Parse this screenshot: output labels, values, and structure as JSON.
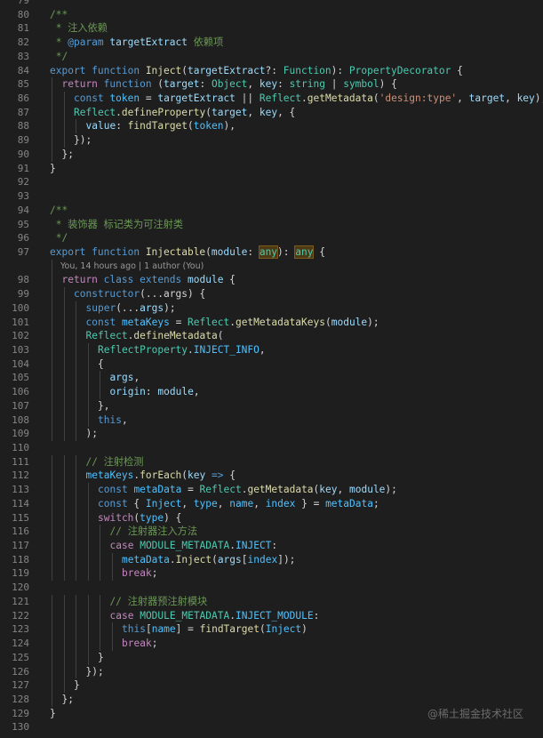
{
  "lines": [
    {
      "n": "79",
      "i": 0,
      "t": []
    },
    {
      "n": "80",
      "i": 0,
      "t": [
        [
          "cm",
          "/**"
        ]
      ]
    },
    {
      "n": "81",
      "i": 0,
      "t": [
        [
          "cm",
          " * 注入依赖"
        ]
      ]
    },
    {
      "n": "82",
      "i": 0,
      "t": [
        [
          "cm",
          " * "
        ],
        [
          "k",
          "@param"
        ],
        [
          "cm",
          " "
        ],
        [
          "v",
          "targetExtract"
        ],
        [
          "cm",
          " 依赖项"
        ]
      ]
    },
    {
      "n": "83",
      "i": 0,
      "t": [
        [
          "cm",
          " */"
        ]
      ]
    },
    {
      "n": "84",
      "i": 0,
      "t": [
        [
          "k",
          "export"
        ],
        [
          "p",
          " "
        ],
        [
          "k",
          "function"
        ],
        [
          "p",
          " "
        ],
        [
          "fn",
          "Inject"
        ],
        [
          "p",
          "("
        ],
        [
          "v",
          "targetExtract"
        ],
        [
          "p",
          "?: "
        ],
        [
          "ty",
          "Function"
        ],
        [
          "p",
          "): "
        ],
        [
          "ty",
          "PropertyDecorator"
        ],
        [
          "p",
          " {"
        ]
      ]
    },
    {
      "n": "85",
      "i": 1,
      "t": [
        [
          "c",
          "return"
        ],
        [
          "p",
          " "
        ],
        [
          "k",
          "function"
        ],
        [
          "p",
          " ("
        ],
        [
          "v",
          "target"
        ],
        [
          "p",
          ": "
        ],
        [
          "ty",
          "Object"
        ],
        [
          "p",
          ", "
        ],
        [
          "v",
          "key"
        ],
        [
          "p",
          ": "
        ],
        [
          "ty",
          "string"
        ],
        [
          "p",
          " | "
        ],
        [
          "ty",
          "symbol"
        ],
        [
          "p",
          ") {"
        ]
      ]
    },
    {
      "n": "86",
      "i": 2,
      "t": [
        [
          "k",
          "const"
        ],
        [
          "p",
          " "
        ],
        [
          "cv",
          "token"
        ],
        [
          "p",
          " = "
        ],
        [
          "v",
          "targetExtract"
        ],
        [
          "p",
          " || "
        ],
        [
          "ty",
          "Reflect"
        ],
        [
          "p",
          "."
        ],
        [
          "fn",
          "getMetadata"
        ],
        [
          "p",
          "("
        ],
        [
          "s",
          "'design:type'"
        ],
        [
          "p",
          ", "
        ],
        [
          "v",
          "target"
        ],
        [
          "p",
          ", "
        ],
        [
          "v",
          "key"
        ],
        [
          "p",
          ");"
        ]
      ]
    },
    {
      "n": "87",
      "i": 2,
      "t": [
        [
          "ty",
          "Reflect"
        ],
        [
          "p",
          "."
        ],
        [
          "fn",
          "defineProperty"
        ],
        [
          "p",
          "("
        ],
        [
          "v",
          "target"
        ],
        [
          "p",
          ", "
        ],
        [
          "v",
          "key"
        ],
        [
          "p",
          ", {"
        ]
      ]
    },
    {
      "n": "88",
      "i": 3,
      "t": [
        [
          "v",
          "value"
        ],
        [
          "p",
          ": "
        ],
        [
          "fn",
          "findTarget"
        ],
        [
          "p",
          "("
        ],
        [
          "cv",
          "token"
        ],
        [
          "p",
          "),"
        ]
      ]
    },
    {
      "n": "89",
      "i": 2,
      "t": [
        [
          "p",
          "});"
        ]
      ]
    },
    {
      "n": "90",
      "i": 1,
      "t": [
        [
          "p",
          "};"
        ]
      ]
    },
    {
      "n": "91",
      "i": 0,
      "t": [
        [
          "p",
          "}"
        ]
      ]
    },
    {
      "n": "92",
      "i": 0,
      "t": []
    },
    {
      "n": "93",
      "i": 0,
      "t": []
    },
    {
      "n": "94",
      "i": 0,
      "t": [
        [
          "cm",
          "/**"
        ]
      ]
    },
    {
      "n": "95",
      "i": 0,
      "t": [
        [
          "cm",
          " * 装饰器 标记类为可注射类"
        ]
      ]
    },
    {
      "n": "96",
      "i": 0,
      "t": [
        [
          "cm",
          " */"
        ]
      ]
    },
    {
      "n": "97",
      "i": 0,
      "t": [
        [
          "k",
          "export"
        ],
        [
          "p",
          " "
        ],
        [
          "k",
          "function"
        ],
        [
          "p",
          " "
        ],
        [
          "fn",
          "Injectable"
        ],
        [
          "p",
          "("
        ],
        [
          "v",
          "module"
        ],
        [
          "p",
          ": "
        ],
        [
          "hl",
          "any"
        ],
        [
          "p",
          "): "
        ],
        [
          "hl",
          "any"
        ],
        [
          "p",
          " {"
        ]
      ]
    },
    {
      "lens": "You, 14 hours ago | 1 author (You)"
    },
    {
      "n": "98",
      "i": 1,
      "t": [
        [
          "c",
          "return"
        ],
        [
          "p",
          " "
        ],
        [
          "k",
          "class"
        ],
        [
          "p",
          " "
        ],
        [
          "k",
          "extends"
        ],
        [
          "p",
          " "
        ],
        [
          "v",
          "module"
        ],
        [
          "p",
          " {"
        ]
      ]
    },
    {
      "n": "99",
      "i": 2,
      "t": [
        [
          "k",
          "constructor"
        ],
        [
          "p",
          "(...args) {"
        ]
      ]
    },
    {
      "n": "100",
      "i": 3,
      "t": [
        [
          "k",
          "super"
        ],
        [
          "p",
          "(..."
        ],
        [
          "v",
          "args"
        ],
        [
          "p",
          ");"
        ]
      ]
    },
    {
      "n": "101",
      "i": 3,
      "t": [
        [
          "k",
          "const"
        ],
        [
          "p",
          " "
        ],
        [
          "cv",
          "metaKeys"
        ],
        [
          "p",
          " = "
        ],
        [
          "ty",
          "Reflect"
        ],
        [
          "p",
          "."
        ],
        [
          "fn",
          "getMetadataKeys"
        ],
        [
          "p",
          "("
        ],
        [
          "v",
          "module"
        ],
        [
          "p",
          ");"
        ]
      ]
    },
    {
      "n": "102",
      "i": 3,
      "t": [
        [
          "ty",
          "Reflect"
        ],
        [
          "p",
          "."
        ],
        [
          "fn",
          "defineMetadata"
        ],
        [
          "p",
          "("
        ]
      ]
    },
    {
      "n": "103",
      "i": 4,
      "t": [
        [
          "ty",
          "ReflectProperty"
        ],
        [
          "p",
          "."
        ],
        [
          "cv",
          "INJECT_INFO"
        ],
        [
          "p",
          ","
        ]
      ]
    },
    {
      "n": "104",
      "i": 4,
      "t": [
        [
          "p",
          "{"
        ]
      ]
    },
    {
      "n": "105",
      "i": 5,
      "t": [
        [
          "v",
          "args"
        ],
        [
          "p",
          ","
        ]
      ]
    },
    {
      "n": "106",
      "i": 5,
      "t": [
        [
          "v",
          "origin"
        ],
        [
          "p",
          ": "
        ],
        [
          "v",
          "module"
        ],
        [
          "p",
          ","
        ]
      ]
    },
    {
      "n": "107",
      "i": 4,
      "t": [
        [
          "p",
          "},"
        ]
      ]
    },
    {
      "n": "108",
      "i": 4,
      "t": [
        [
          "k",
          "this"
        ],
        [
          "p",
          ","
        ]
      ]
    },
    {
      "n": "109",
      "i": 3,
      "t": [
        [
          "p",
          ");"
        ]
      ]
    },
    {
      "n": "110",
      "i": 0,
      "t": []
    },
    {
      "n": "111",
      "i": 3,
      "t": [
        [
          "cm",
          "// 注射检测"
        ]
      ]
    },
    {
      "n": "112",
      "i": 3,
      "t": [
        [
          "cv",
          "metaKeys"
        ],
        [
          "p",
          "."
        ],
        [
          "fn",
          "forEach"
        ],
        [
          "p",
          "("
        ],
        [
          "v",
          "key"
        ],
        [
          "p",
          " "
        ],
        [
          "k",
          "=>"
        ],
        [
          "p",
          " {"
        ]
      ]
    },
    {
      "n": "113",
      "i": 4,
      "t": [
        [
          "k",
          "const"
        ],
        [
          "p",
          " "
        ],
        [
          "cv",
          "metaData"
        ],
        [
          "p",
          " = "
        ],
        [
          "ty",
          "Reflect"
        ],
        [
          "p",
          "."
        ],
        [
          "fn",
          "getMetadata"
        ],
        [
          "p",
          "("
        ],
        [
          "v",
          "key"
        ],
        [
          "p",
          ", "
        ],
        [
          "v",
          "module"
        ],
        [
          "p",
          ");"
        ]
      ]
    },
    {
      "n": "114",
      "i": 4,
      "t": [
        [
          "k",
          "const"
        ],
        [
          "p",
          " { "
        ],
        [
          "cv",
          "Inject"
        ],
        [
          "p",
          ", "
        ],
        [
          "cv",
          "type"
        ],
        [
          "p",
          ", "
        ],
        [
          "cv",
          "name"
        ],
        [
          "p",
          ", "
        ],
        [
          "cv",
          "index"
        ],
        [
          "p",
          " } = "
        ],
        [
          "cv",
          "metaData"
        ],
        [
          "p",
          ";"
        ]
      ]
    },
    {
      "n": "115",
      "i": 4,
      "t": [
        [
          "c",
          "switch"
        ],
        [
          "p",
          "("
        ],
        [
          "cv",
          "type"
        ],
        [
          "p",
          ") {"
        ]
      ]
    },
    {
      "n": "116",
      "i": 5,
      "t": [
        [
          "cm",
          "// 注射器注入方法"
        ]
      ]
    },
    {
      "n": "117",
      "i": 5,
      "t": [
        [
          "c",
          "case"
        ],
        [
          "p",
          " "
        ],
        [
          "ty",
          "MODULE_METADATA"
        ],
        [
          "p",
          "."
        ],
        [
          "cv",
          "INJECT"
        ],
        [
          "p",
          ":"
        ]
      ]
    },
    {
      "n": "118",
      "i": 6,
      "t": [
        [
          "cv",
          "metaData"
        ],
        [
          "p",
          "."
        ],
        [
          "fn",
          "Inject"
        ],
        [
          "p",
          "("
        ],
        [
          "v",
          "args"
        ],
        [
          "p",
          "["
        ],
        [
          "cv",
          "index"
        ],
        [
          "p",
          "]);"
        ]
      ]
    },
    {
      "n": "119",
      "i": 6,
      "t": [
        [
          "c",
          "break"
        ],
        [
          "p",
          ";"
        ]
      ]
    },
    {
      "n": "120",
      "i": 0,
      "t": []
    },
    {
      "n": "121",
      "i": 5,
      "t": [
        [
          "cm",
          "// 注射器预注射模块"
        ]
      ]
    },
    {
      "n": "122",
      "i": 5,
      "t": [
        [
          "c",
          "case"
        ],
        [
          "p",
          " "
        ],
        [
          "ty",
          "MODULE_METADATA"
        ],
        [
          "p",
          "."
        ],
        [
          "cv",
          "INJECT_MODULE"
        ],
        [
          "p",
          ":"
        ]
      ]
    },
    {
      "n": "123",
      "i": 6,
      "t": [
        [
          "k",
          "this"
        ],
        [
          "p",
          "["
        ],
        [
          "cv",
          "name"
        ],
        [
          "p",
          "] = "
        ],
        [
          "fn",
          "findTarget"
        ],
        [
          "p",
          "("
        ],
        [
          "cv",
          "Inject"
        ],
        [
          "p",
          ")"
        ]
      ]
    },
    {
      "n": "124",
      "i": 6,
      "t": [
        [
          "c",
          "break"
        ],
        [
          "p",
          ";"
        ]
      ]
    },
    {
      "n": "125",
      "i": 4,
      "t": [
        [
          "p",
          "}"
        ]
      ]
    },
    {
      "n": "126",
      "i": 3,
      "t": [
        [
          "p",
          "});"
        ]
      ]
    },
    {
      "n": "127",
      "i": 2,
      "t": [
        [
          "p",
          "}"
        ]
      ]
    },
    {
      "n": "128",
      "i": 1,
      "t": [
        [
          "p",
          "};"
        ]
      ]
    },
    {
      "n": "129",
      "i": 0,
      "t": [
        [
          "p",
          "}"
        ]
      ]
    },
    {
      "n": "130",
      "i": 0,
      "t": []
    }
  ],
  "watermark": "@稀土掘金技术社区",
  "colors": {
    "background": "#1e1e1e",
    "line_number": "#858585",
    "keyword": "#569cd6",
    "control": "#c586c0",
    "function": "#dcdcaa",
    "variable": "#9cdcfe",
    "constant": "#4fc1ff",
    "type": "#4ec9b0",
    "string": "#ce9178",
    "comment": "#6a9955"
  }
}
